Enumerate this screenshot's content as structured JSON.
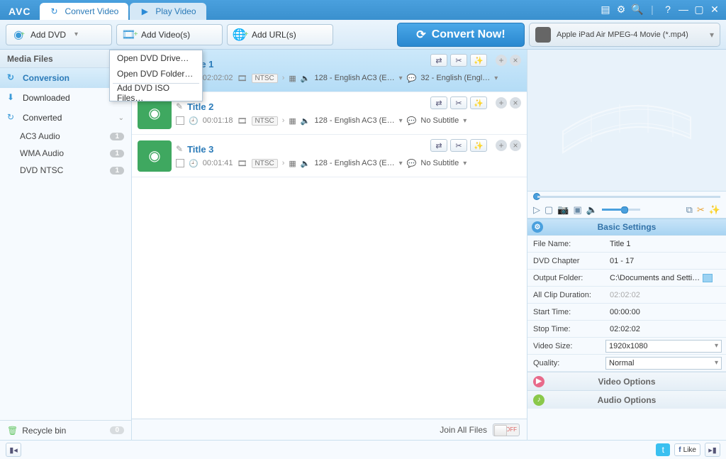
{
  "titlebar": {
    "logo": "AVC",
    "tabs": [
      {
        "label": "Convert Video",
        "active": true
      },
      {
        "label": "Play Video",
        "active": false
      }
    ]
  },
  "toolbar": {
    "add_dvd": "Add DVD",
    "add_videos": "Add Video(s)",
    "add_urls": "Add URL(s)",
    "convert": "Convert Now!",
    "profile": "Apple iPad Air MPEG-4 Movie (*.mp4)"
  },
  "dropdown": {
    "items": [
      "Open DVD Drive…",
      "Open DVD Folder…",
      "Add DVD ISO Files…"
    ]
  },
  "sidebar": {
    "header": "Media Files",
    "items": [
      {
        "label": "Conversion",
        "active": true
      },
      {
        "label": "Downloaded",
        "active": false
      },
      {
        "label": "Converted",
        "active": false
      }
    ],
    "subs": [
      {
        "label": "AC3 Audio",
        "count": "1"
      },
      {
        "label": "WMA Audio",
        "count": "1"
      },
      {
        "label": "DVD NTSC",
        "count": "1"
      }
    ],
    "recycle": "Recycle bin",
    "recycle_count": "0"
  },
  "items": [
    {
      "title": "Title 1",
      "duration": "02:02:02",
      "std": "NTSC",
      "audio": "128 - English AC3 (E…",
      "subtitle": "32 - English (Engl…",
      "selected": true
    },
    {
      "title": "Title 2",
      "duration": "00:01:18",
      "std": "NTSC",
      "audio": "128 - English AC3 (E…",
      "subtitle": "No Subtitle",
      "selected": false
    },
    {
      "title": "Title 3",
      "duration": "00:01:41",
      "std": "NTSC",
      "audio": "128 - English AC3 (E…",
      "subtitle": "No Subtitle",
      "selected": false
    }
  ],
  "centerfoot": {
    "join": "Join All Files",
    "toggle": "OFF"
  },
  "settings": {
    "header": "Basic Settings",
    "rows": {
      "fileName": {
        "k": "File Name:",
        "v": "Title 1"
      },
      "chapter": {
        "k": "DVD Chapter",
        "v": "01 -  17"
      },
      "outFolder": {
        "k": "Output Folder:",
        "v": "C:\\Documents and Setti…"
      },
      "allDur": {
        "k": "All Clip Duration:",
        "v": "02:02:02"
      },
      "start": {
        "k": "Start Time:",
        "v": "00:00:00"
      },
      "stop": {
        "k": "Stop Time:",
        "v": "02:02:02"
      },
      "vsize": {
        "k": "Video Size:",
        "v": "1920x1080"
      },
      "quality": {
        "k": "Quality:",
        "v": "Normal"
      }
    },
    "videoOpts": "Video Options",
    "audioOpts": "Audio Options"
  },
  "social": {
    "like": "Like"
  }
}
